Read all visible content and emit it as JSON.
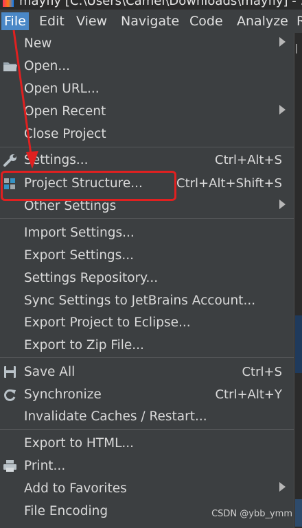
{
  "titlebar": {
    "text": "mayfly [C:\\Users\\Camel\\Downloads\\mayfly] - ..."
  },
  "menubar": [
    {
      "label": "File"
    },
    {
      "label": "Edit"
    },
    {
      "label": "View"
    },
    {
      "label": "Navigate"
    },
    {
      "label": "Code"
    },
    {
      "label": "Analyze"
    },
    {
      "label": "R"
    }
  ],
  "file_menu": [
    {
      "label": "New",
      "shortcut": "",
      "submenu": true,
      "icon": ""
    },
    {
      "label": "Open...",
      "shortcut": "",
      "submenu": false,
      "icon": "folder-icon"
    },
    {
      "label": "Open URL...",
      "shortcut": "",
      "submenu": false,
      "icon": ""
    },
    {
      "label": "Open Recent",
      "shortcut": "",
      "submenu": true,
      "icon": ""
    },
    {
      "label": "Close Project",
      "shortcut": "",
      "submenu": false,
      "icon": ""
    },
    {
      "label": "Settings...",
      "shortcut": "Ctrl+Alt+S",
      "submenu": false,
      "icon": "wrench-icon"
    },
    {
      "label": "Project Structure...",
      "shortcut": "Ctrl+Alt+Shift+S",
      "submenu": false,
      "icon": "project-structure-icon"
    },
    {
      "label": "Other Settings",
      "shortcut": "",
      "submenu": true,
      "icon": ""
    },
    {
      "label": "Import Settings...",
      "shortcut": "",
      "submenu": false,
      "icon": ""
    },
    {
      "label": "Export Settings...",
      "shortcut": "",
      "submenu": false,
      "icon": ""
    },
    {
      "label": "Settings Repository...",
      "shortcut": "",
      "submenu": false,
      "icon": ""
    },
    {
      "label": "Sync Settings to JetBrains Account...",
      "shortcut": "",
      "submenu": false,
      "icon": ""
    },
    {
      "label": "Export Project to Eclipse...",
      "shortcut": "",
      "submenu": false,
      "icon": ""
    },
    {
      "label": "Export to Zip File...",
      "shortcut": "",
      "submenu": false,
      "icon": ""
    },
    {
      "label": "Save All",
      "shortcut": "Ctrl+S",
      "submenu": false,
      "icon": "save-icon"
    },
    {
      "label": "Synchronize",
      "shortcut": "Ctrl+Alt+Y",
      "submenu": false,
      "icon": "sync-icon"
    },
    {
      "label": "Invalidate Caches / Restart...",
      "shortcut": "",
      "submenu": false,
      "icon": ""
    },
    {
      "label": "Export to HTML...",
      "shortcut": "",
      "submenu": false,
      "icon": ""
    },
    {
      "label": "Print...",
      "shortcut": "",
      "submenu": false,
      "icon": "print-icon"
    },
    {
      "label": "Add to Favorites",
      "shortcut": "",
      "submenu": true,
      "icon": ""
    },
    {
      "label": "File Encoding",
      "shortcut": "",
      "submenu": false,
      "icon": ""
    }
  ],
  "annotation": {
    "color": "#e02020"
  },
  "watermark": "CSDN @ybb_ymm",
  "colors": {
    "menu_bg": "#3c3f41",
    "active_menu": "#4a88c7",
    "text": "#dadada"
  }
}
